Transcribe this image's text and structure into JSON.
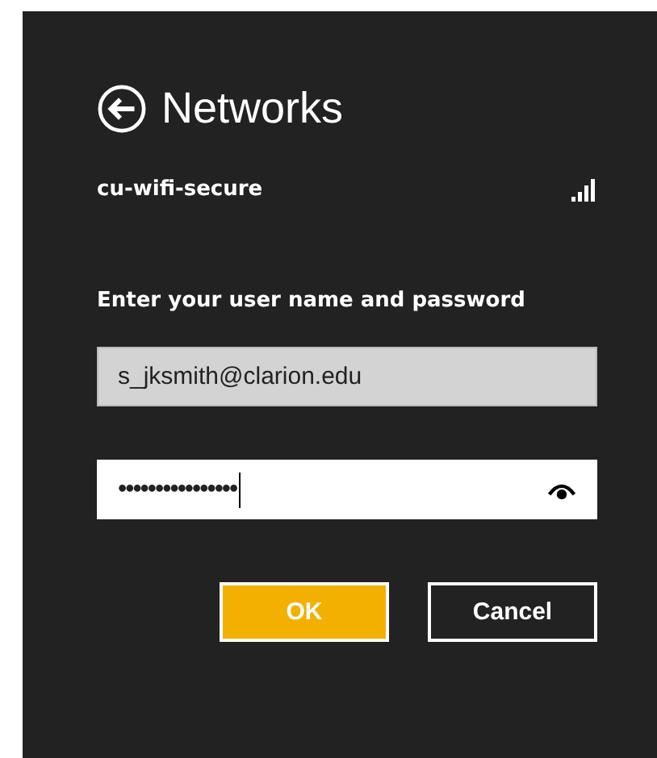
{
  "header": {
    "title": "Networks"
  },
  "network": {
    "name": "cu-wifi-secure"
  },
  "prompt": "Enter your user name and password",
  "username": {
    "value": "s_jksmith@clarion.edu",
    "focused": false
  },
  "password": {
    "value": "••••••••••••••••",
    "focused": true
  },
  "buttons": [
    {
      "label": "OK",
      "kind": "primary"
    },
    {
      "label": "Cancel",
      "kind": "secondary"
    }
  ]
}
